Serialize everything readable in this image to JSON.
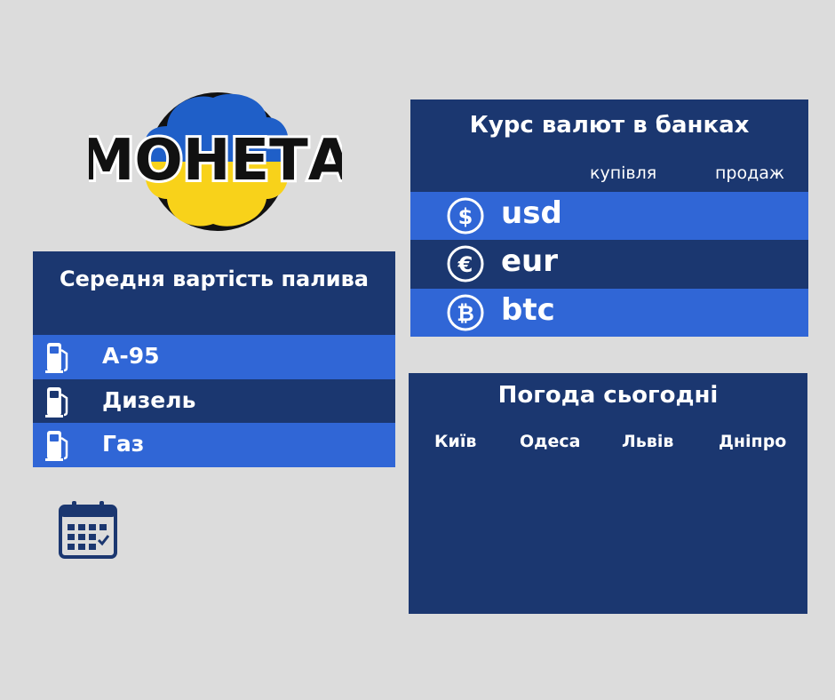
{
  "logo": {
    "text": "МОНЕТА",
    "colors": {
      "blue": "#1f5fc8",
      "yellow": "#f8d21a",
      "black": "#111111"
    }
  },
  "fuel": {
    "title": "Середня вартість палива",
    "items": [
      {
        "label": "А-95",
        "icon": "fuel-pump-icon"
      },
      {
        "label": "Дизель",
        "icon": "fuel-pump-icon"
      },
      {
        "label": "Газ",
        "icon": "fuel-pump-icon"
      }
    ]
  },
  "currency": {
    "title": "Курс валют в банках",
    "columns": {
      "buy": "купівля",
      "sell": "продаж"
    },
    "items": [
      {
        "code": "usd",
        "icon": "dollar-icon"
      },
      {
        "code": "eur",
        "icon": "euro-icon"
      },
      {
        "code": "btc",
        "icon": "bitcoin-icon"
      }
    ]
  },
  "weather": {
    "title": "Погода сьогодні",
    "cities": [
      "Київ",
      "Одеса",
      "Львів",
      "Дніпро"
    ]
  },
  "calendar": {
    "icon": "calendar-icon"
  },
  "colors": {
    "background": "#dcdcdc",
    "panel_dark": "#1b3770",
    "row_light": "#3066d6",
    "text": "#ffffff"
  }
}
